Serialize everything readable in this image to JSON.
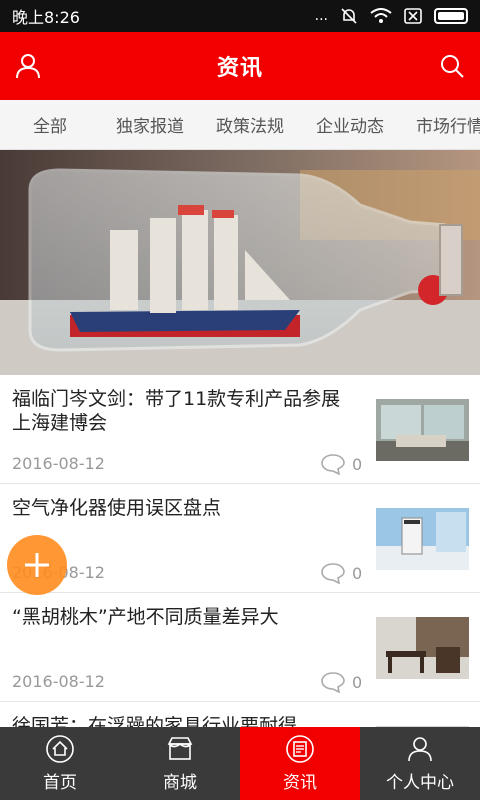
{
  "status_bar": {
    "time": "晚上8:26",
    "dots": "...",
    "icons": [
      "silent-bell-icon",
      "wifi-icon",
      "sim-x-icon",
      "battery-icon"
    ]
  },
  "header": {
    "title": "资讯",
    "left_icon": "user-icon",
    "right_icon": "search-icon"
  },
  "tabs": [
    "全部",
    "独家报道",
    "政策法规",
    "企业动态",
    "市场行情"
  ],
  "banner": {
    "image": "ship-in-bottle"
  },
  "news": [
    {
      "title": "福临门岑文剑：带了11款专利产品参展上海建博会",
      "date": "2016-08-12",
      "comments": "0",
      "thumb": "living-room"
    },
    {
      "title": "空气净化器使用误区盘点",
      "date": "2016-08-12",
      "comments": "0",
      "thumb": "air-purifier"
    },
    {
      "title": "“黑胡桃木”产地不同质量差异大",
      "date": "2016-08-12",
      "comments": "0",
      "thumb": "dining-room"
    },
    {
      "title": "徐国芳：在浮躁的家具行业要耐得",
      "date": "",
      "comments": "",
      "thumb": ""
    }
  ],
  "bottom_nav": [
    {
      "label": "首页",
      "icon": "home-icon"
    },
    {
      "label": "商城",
      "icon": "shop-icon"
    },
    {
      "label": "资讯",
      "icon": "news-icon"
    },
    {
      "label": "个人中心",
      "icon": "profile-icon"
    }
  ],
  "colors": {
    "primary": "#f20000",
    "nav_bg": "#3a3a3a",
    "fab": "#ff8c1e"
  }
}
